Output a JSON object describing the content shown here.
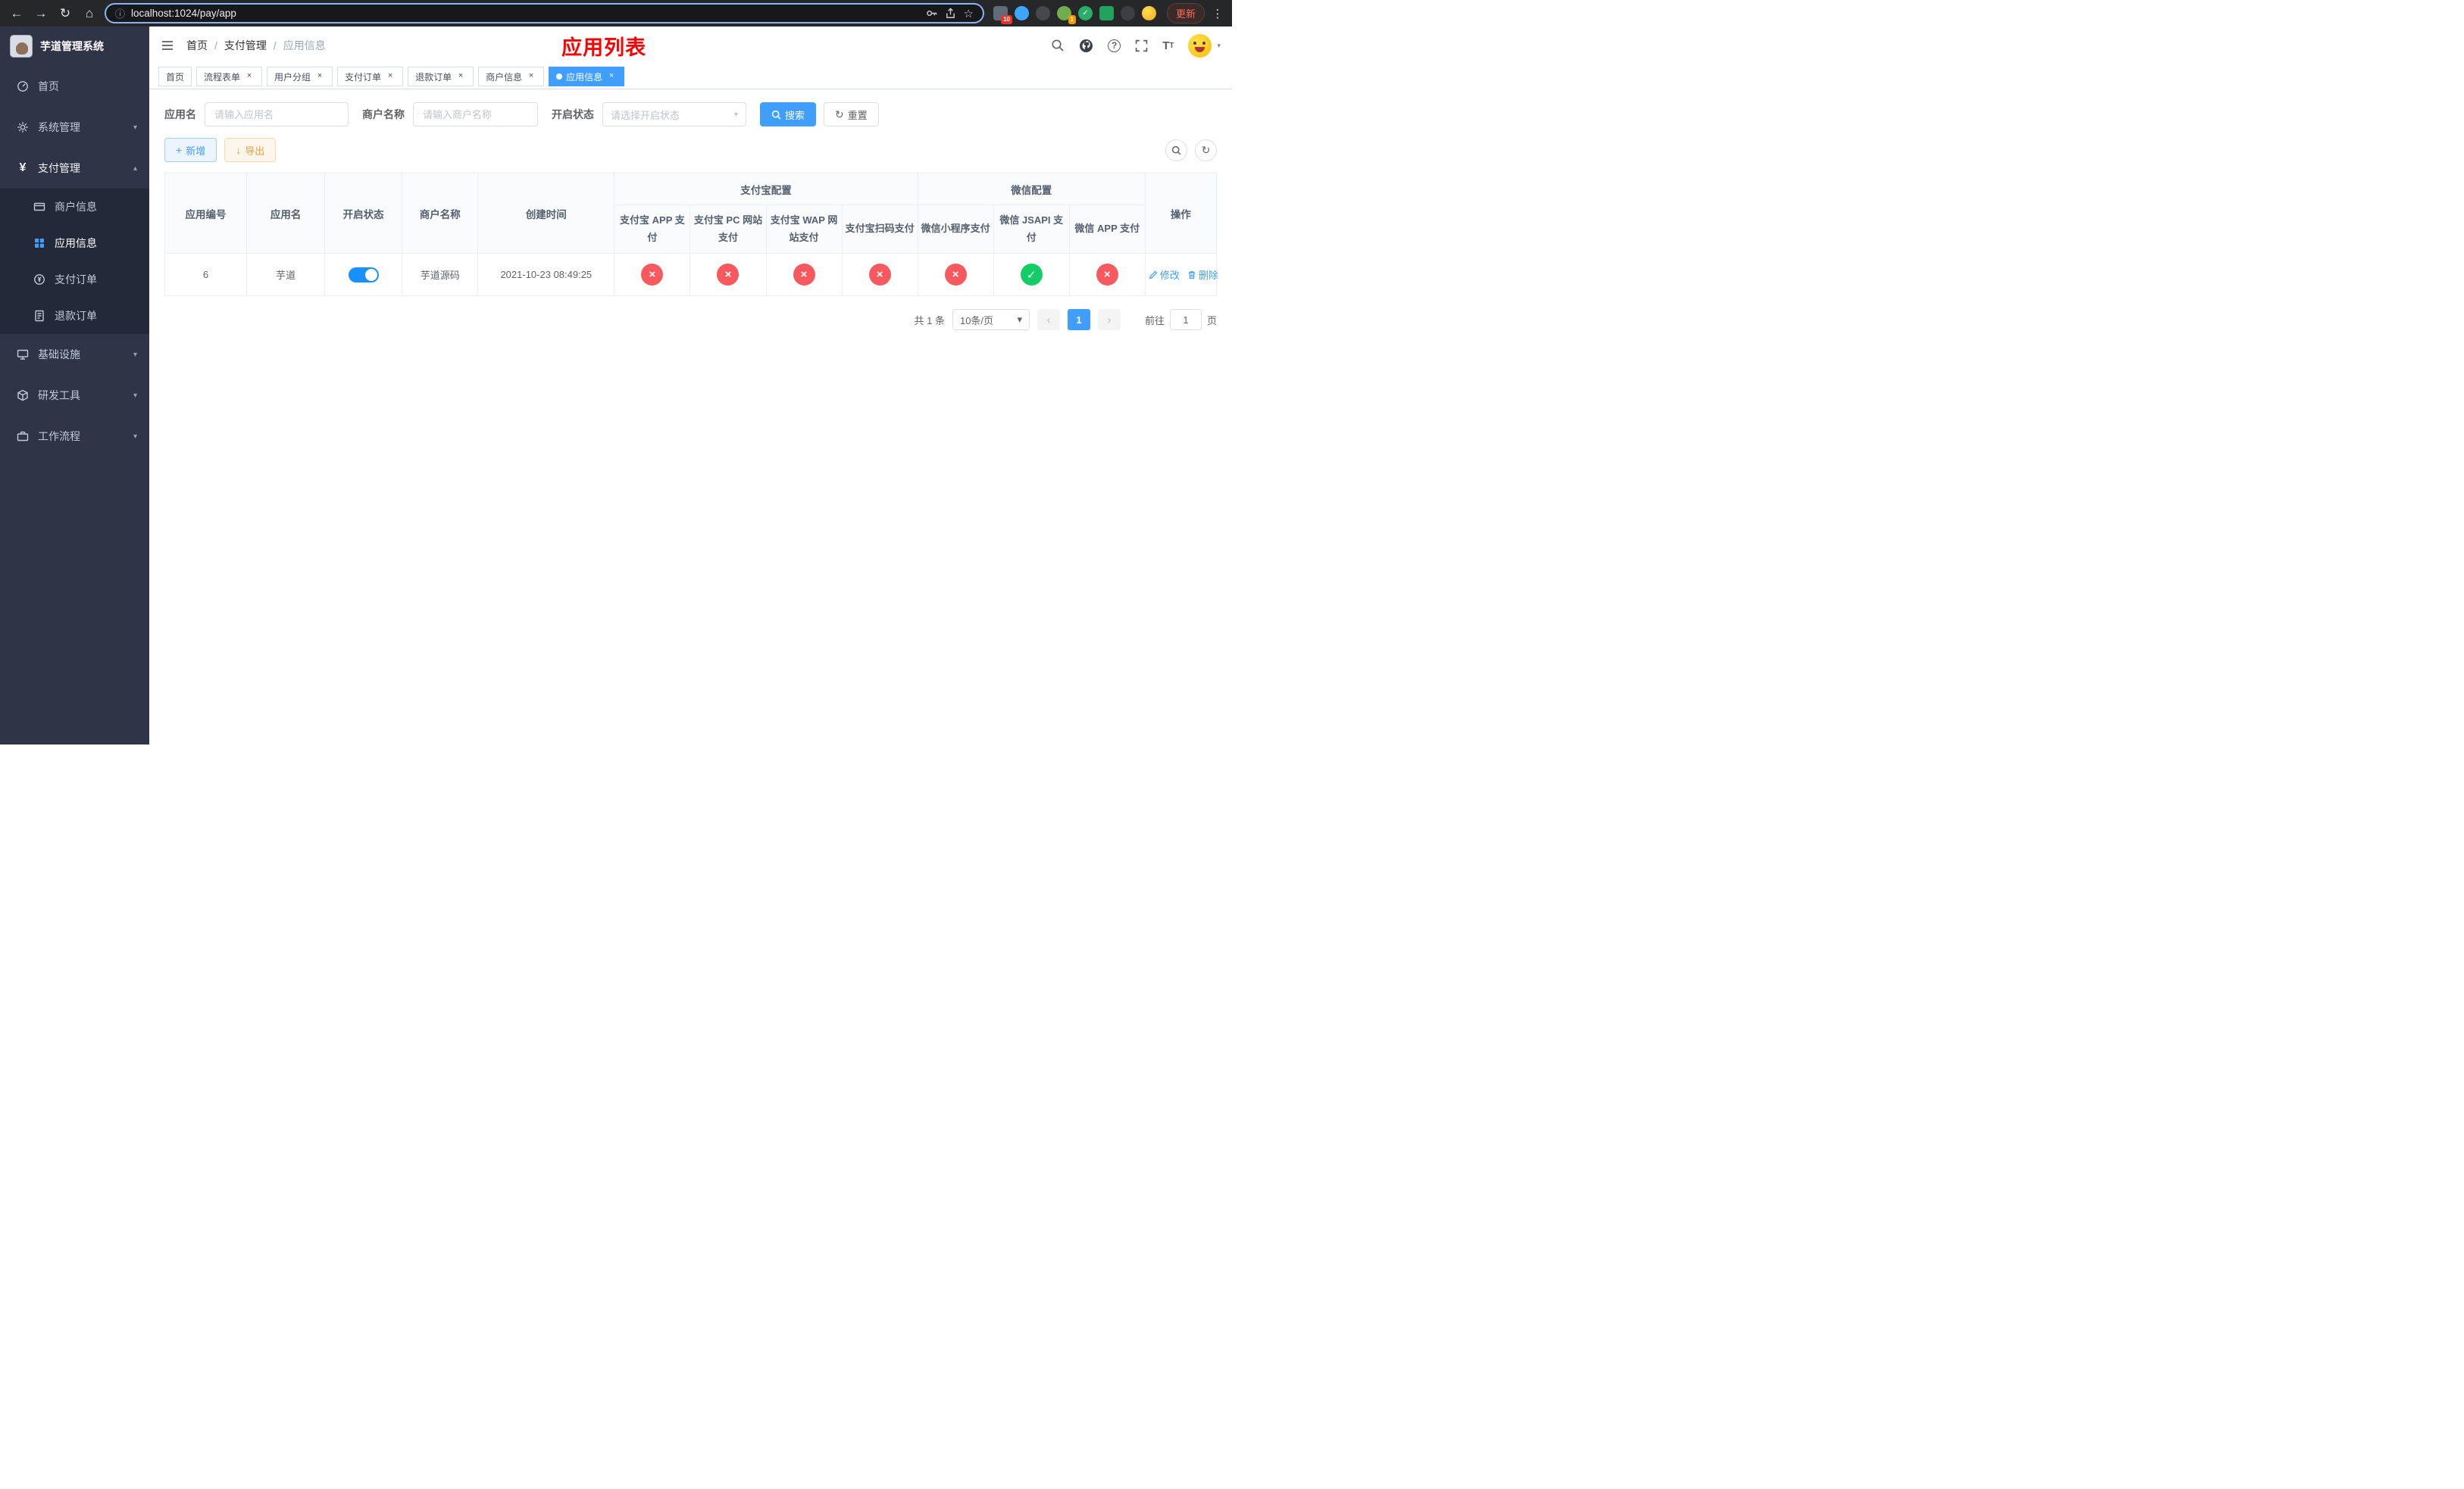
{
  "colors": {
    "accent": "#409eff",
    "danger": "#f8595f",
    "success": "#13ce66",
    "warning": "#e6a23c",
    "title_red": "#ff0000",
    "toggle_on": "#1890ff"
  },
  "icons": {
    "back": "←",
    "forward": "→",
    "reload": "↻",
    "home": "⌂",
    "info": "ⓘ",
    "star": "☆",
    "kebab": "⋮",
    "caret": "▾",
    "chevron_down": "▾",
    "chevron_up": "▴",
    "plus": "+",
    "download": "↓",
    "reset": "↻",
    "check": "✓",
    "cross": "×",
    "prev": "‹",
    "next": "›",
    "close": "×",
    "yen": "¥",
    "question": "?",
    "font_big": "T",
    "font_small": "T"
  },
  "browser": {
    "url": "localhost:1024/pay/app",
    "update_label": "更新",
    "ext_badge_10": "10",
    "ext_badge_1": "1"
  },
  "sidebar": {
    "title": "芋道管理系统",
    "items": [
      {
        "label": "首页"
      },
      {
        "label": "系统管理"
      },
      {
        "label": "支付管理",
        "children": [
          {
            "label": "商户信息"
          },
          {
            "label": "应用信息",
            "active": true
          },
          {
            "label": "支付订单"
          },
          {
            "label": "退款订单"
          }
        ]
      },
      {
        "label": "基础设施"
      },
      {
        "label": "研发工具"
      },
      {
        "label": "工作流程"
      }
    ]
  },
  "header": {
    "breadcrumb": [
      "首页",
      "支付管理",
      "应用信息"
    ],
    "separator": "/",
    "page_title": "应用列表"
  },
  "tabs": [
    {
      "label": "首页",
      "closable": false
    },
    {
      "label": "流程表单",
      "closable": true
    },
    {
      "label": "用户分组",
      "closable": true
    },
    {
      "label": "支付订单",
      "closable": true
    },
    {
      "label": "退款订单",
      "closable": true
    },
    {
      "label": "商户信息",
      "closable": true
    },
    {
      "label": "应用信息",
      "closable": true,
      "active": true
    }
  ],
  "filters": {
    "app_name_label": "应用名",
    "app_name_placeholder": "请输入应用名",
    "merchant_label": "商户名称",
    "merchant_placeholder": "请输入商户名称",
    "status_label": "开启状态",
    "status_placeholder": "请选择开启状态",
    "search_button": "搜索",
    "reset_button": "重置"
  },
  "toolbar": {
    "add_button": "新增",
    "export_button": "导出"
  },
  "table": {
    "group_alipay": "支付宝配置",
    "group_wechat": "微信配置",
    "col_id": "应用编号",
    "col_name": "应用名",
    "col_status": "开启状态",
    "col_merchant": "商户名称",
    "col_created": "创建时间",
    "col_alipay_app": "支付宝 APP 支付",
    "col_alipay_pc": "支付宝 PC 网站支付",
    "col_alipay_wap": "支付宝 WAP 网站支付",
    "col_alipay_qr": "支付宝扫码支付",
    "col_wx_mini": "微信小程序支付",
    "col_wx_jsapi": "微信 JSAPI 支付",
    "col_wx_app": "微信 APP 支付",
    "col_actions": "操作",
    "rows": [
      {
        "id": "6",
        "name": "芋道",
        "enabled": true,
        "merchant": "芋道源码",
        "created": "2021-10-23 08:49:25",
        "alipay_app": false,
        "alipay_pc": false,
        "alipay_wap": false,
        "alipay_qr": false,
        "wx_mini": false,
        "wx_jsapi": true,
        "wx_app": false,
        "edit_label": "修改",
        "delete_label": "删除"
      }
    ]
  },
  "pagination": {
    "total": "共 1 条",
    "page_size": "10条/页",
    "page": "1",
    "goto_prefix": "前往",
    "goto_value": "1",
    "goto_suffix": "页"
  }
}
